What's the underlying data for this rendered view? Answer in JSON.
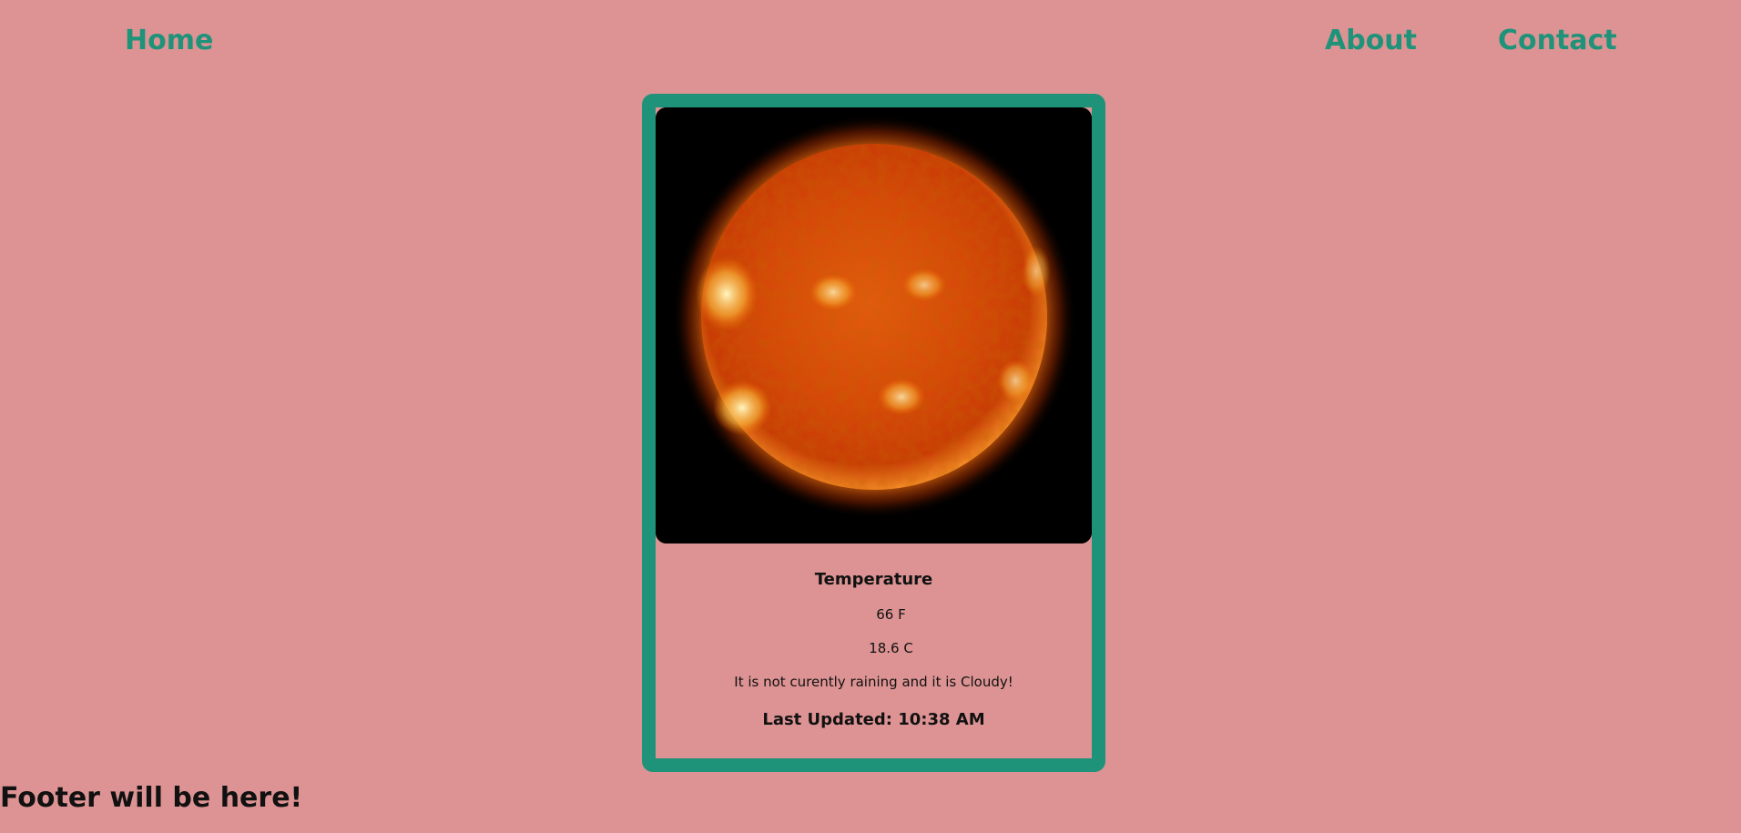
{
  "nav": {
    "home_label": "Home",
    "about_label": "About",
    "contact_label": "Contact"
  },
  "card": {
    "image_icon": "sun-image",
    "temperature_title": "Temperature",
    "temp_f": "66 F",
    "temp_c": "18.6 C",
    "description": "It is not curently raining and it is Cloudy!",
    "last_updated": "Last Updated: 10:38 AM"
  },
  "footer": {
    "text": "Footer will be here!"
  },
  "colors": {
    "background": "#dd9393",
    "accent": "#1e937a"
  }
}
